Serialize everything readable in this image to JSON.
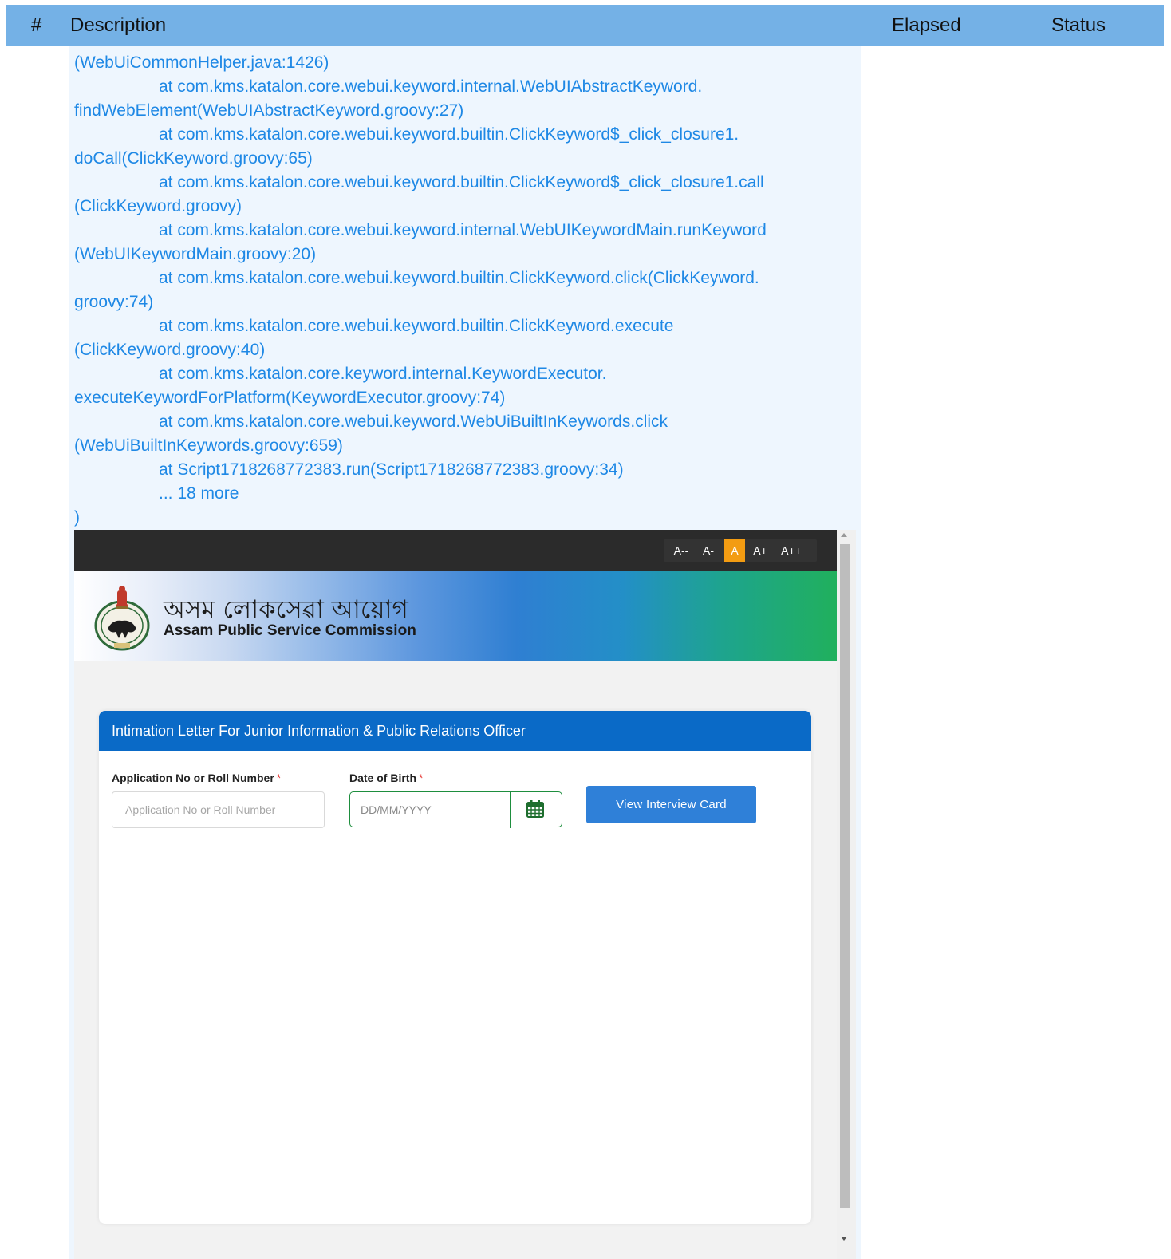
{
  "table": {
    "headers": {
      "num": "#",
      "description": "Description",
      "elapsed": "Elapsed",
      "status": "Status"
    },
    "colors": {
      "header_bg": "#74b1e6",
      "row_bg": "#eef6fe",
      "log_text": "#1e88e5"
    }
  },
  "log_lines": [
    "(WebUiCommonHelper.java:1426)",
    "\tat com.kms.katalon.core.webui.keyword.internal.WebUIAbstractKeyword.",
    "findWebElement(WebUIAbstractKeyword.groovy:27)",
    "\tat com.kms.katalon.core.webui.keyword.builtin.ClickKeyword$_click_closure1.",
    "doCall(ClickKeyword.groovy:65)",
    "\tat com.kms.katalon.core.webui.keyword.builtin.ClickKeyword$_click_closure1.call",
    "(ClickKeyword.groovy)",
    "\tat com.kms.katalon.core.webui.keyword.internal.WebUIKeywordMain.runKeyword",
    "(WebUIKeywordMain.groovy:20)",
    "\tat com.kms.katalon.core.webui.keyword.builtin.ClickKeyword.click(ClickKeyword.",
    "groovy:74)",
    "\tat com.kms.katalon.core.webui.keyword.builtin.ClickKeyword.execute",
    "(ClickKeyword.groovy:40)",
    "\tat com.kms.katalon.core.keyword.internal.KeywordExecutor.",
    "executeKeywordForPlatform(KeywordExecutor.groovy:74)",
    "\tat com.kms.katalon.core.webui.keyword.WebUiBuiltInKeywords.click",
    "(WebUiBuiltInKeywords.groovy:659)",
    "\tat Script1718268772383.run(Script1718268772383.groovy:34)",
    "\t... 18 more",
    ")"
  ],
  "screenshot": {
    "font_sizes": [
      "A--",
      "A-",
      "A",
      "A+",
      "A++"
    ],
    "active_font_size": "A",
    "site_title_assamese": "অসম লোকসেৱা আয়োগ",
    "site_title_english": "Assam Public Service Commission",
    "form": {
      "heading": "Intimation Letter For Junior Information & Public Relations Officer",
      "app_label": "Application No or Roll Number",
      "app_placeholder": "Application No or Roll Number",
      "app_value": "",
      "dob_label": "Date of Birth",
      "dob_placeholder": "DD/MM/YYYY",
      "dob_value": "",
      "required_mark": "*",
      "submit_label": "View Interview Card",
      "calendar_icon": "calendar-icon"
    },
    "colors": {
      "topbar": "#2b2b2b",
      "active_font": "#f39c12",
      "card_header": "#0a6ac7",
      "submit_button": "#2f80d8",
      "dob_border": "#1e8e3e"
    }
  }
}
